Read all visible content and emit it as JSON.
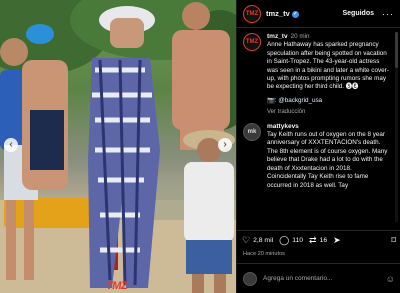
{
  "photo": {
    "watermark": "TMZ",
    "prev_glyph": "‹",
    "next_glyph": "›"
  },
  "header": {
    "avatar_text": "TMZ",
    "username": "tmz_tv",
    "verified_glyph": "✓",
    "follow_label": "Seguidos",
    "more_glyph": "···"
  },
  "comments": [
    {
      "avatar_text": "TMZ",
      "author": "tmz_tv",
      "time": "20 min",
      "text": "Anne Hathaway has sparked pregnancy speculation after being spotted on vacation in Saint-Tropez. The 43-year-old actress was seen in a bikini and later a white cover-up, with photos prompting rumors she may be expecting her third child. 🅢🅔",
      "mention": "📷: @backgrid_usa",
      "translate_label": "Ver traducción"
    },
    {
      "avatar_text": "mk",
      "author": "mattykevs",
      "time": "",
      "text": "Tay Keith runs out of oxygen on the 8 year anniversary of XXXTENTACION's death. The 8th element is of course oxygen. Many believe that Drake had a lot to do with the death of Xxxtentacion in 2018. Coincidentally Tay Keith rise to fame occurred in 2018 as well. Tay"
    }
  ],
  "actions": {
    "likes": "2,8 mil",
    "comments": "110",
    "shares": "16",
    "like_icon": "♡",
    "comment_icon": "◯",
    "share_icon": "⇄",
    "send_icon": "➤",
    "bookmark_icon": "⌑"
  },
  "time_ago": "Hace 20 minutos",
  "add_comment": {
    "placeholder": "Agrega un comentario...",
    "emoji_icon": "☺"
  }
}
